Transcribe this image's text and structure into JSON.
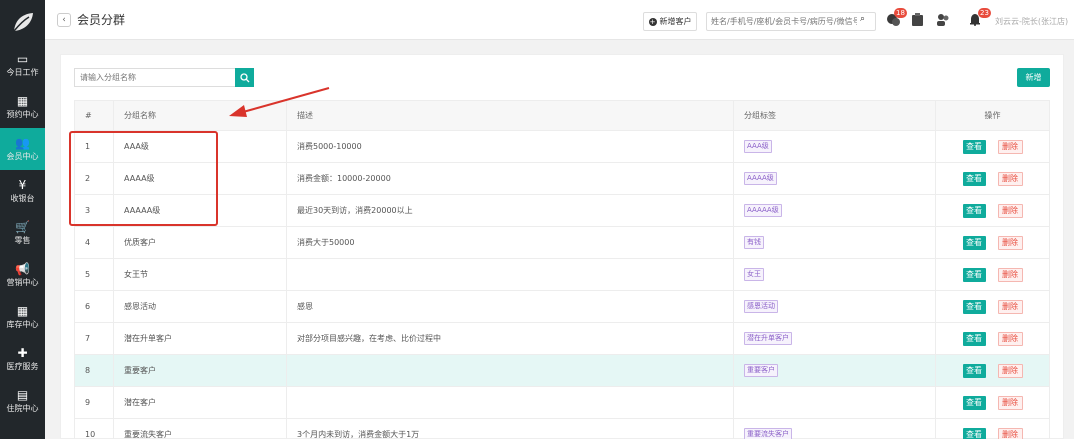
{
  "sidebar": {
    "logo_icon": "leaf-icon",
    "items": [
      {
        "label": "今日工作",
        "icon": "▭",
        "icon_name": "laptop-icon",
        "active": false
      },
      {
        "label": "预约中心",
        "icon": "▦",
        "icon_name": "calendar-icon",
        "active": false
      },
      {
        "label": "会员中心",
        "icon": "👥",
        "icon_name": "members-icon",
        "active": true
      },
      {
        "label": "收银台",
        "icon": "¥",
        "icon_name": "yen-icon",
        "active": false
      },
      {
        "label": "零售",
        "icon": "🛒",
        "icon_name": "cart-icon",
        "active": false
      },
      {
        "label": "营销中心",
        "icon": "📢",
        "icon_name": "megaphone-icon",
        "active": false
      },
      {
        "label": "库存中心",
        "icon": "▦",
        "icon_name": "grid-icon",
        "active": false
      },
      {
        "label": "医疗服务",
        "icon": "✚",
        "icon_name": "medical-kit-icon",
        "active": false
      },
      {
        "label": "住院中心",
        "icon": "▤",
        "icon_name": "clipboard-icon",
        "active": false
      }
    ]
  },
  "header": {
    "title": "会员分群",
    "back_icon": "‹",
    "new_customer_label": "新增客户",
    "search_placeholder": "姓名/手机号/座机/会员卡号/病历号/微信号",
    "search_icon": "search-icon",
    "badge_1": "18",
    "badge_2": "23",
    "user": "刘云云-院长(张江店)"
  },
  "content": {
    "group_search_placeholder": "请输入分组名称",
    "add_label": "新增",
    "columns": [
      "#",
      "分组名称",
      "描述",
      "分组标签",
      "操作"
    ],
    "view_label": "查看",
    "delete_label": "删除",
    "rows": [
      {
        "no": "1",
        "name": "AAA级",
        "desc": "消费5000-10000",
        "tag": "AAA级"
      },
      {
        "no": "2",
        "name": "AAAA级",
        "desc": "消费金额：10000-20000",
        "tag": "AAAA级"
      },
      {
        "no": "3",
        "name": "AAAAA级",
        "desc": "最近30天到访，消费20000以上",
        "tag": "AAAAA级"
      },
      {
        "no": "4",
        "name": "优质客户",
        "desc": "消费大于50000",
        "tag": "有钱"
      },
      {
        "no": "5",
        "name": "女王节",
        "desc": "",
        "tag": "女王"
      },
      {
        "no": "6",
        "name": "感恩活动",
        "desc": "感恩",
        "tag": "感恩活动"
      },
      {
        "no": "7",
        "name": "潜在升单客户",
        "desc": "对部分项目感兴趣，在考虑、比价过程中",
        "tag": "潜在升单客户"
      },
      {
        "no": "8",
        "name": "重要客户",
        "desc": "",
        "tag": "重要客户"
      },
      {
        "no": "9",
        "name": "潜在客户",
        "desc": "",
        "tag": ""
      },
      {
        "no": "10",
        "name": "重要流失客户",
        "desc": "3个月内未到访，消费金额大于1万",
        "tag": "重要流失客户"
      }
    ]
  },
  "colors": {
    "accent": "#0fab9c",
    "sidebar_bg": "#22272b",
    "annotation": "#d9342b",
    "delete": "#e84c3d",
    "tag": "#8a5fc8"
  }
}
